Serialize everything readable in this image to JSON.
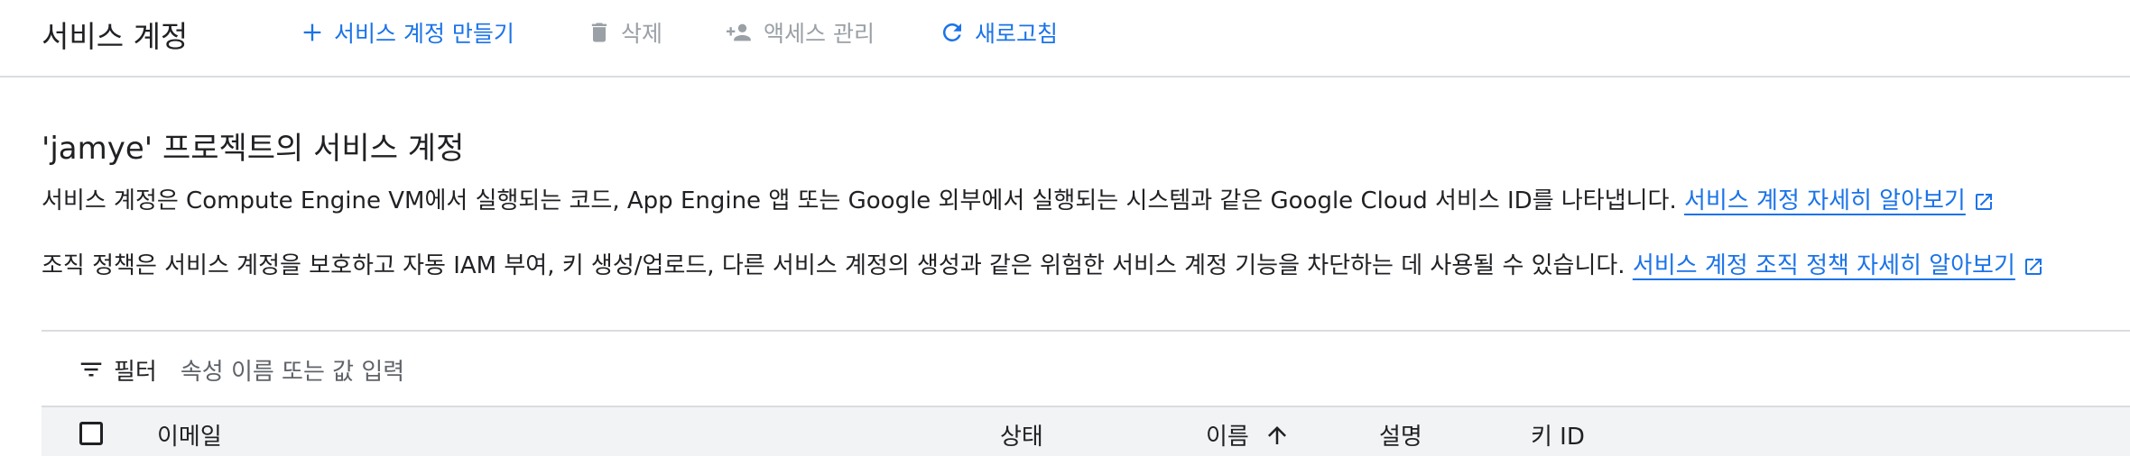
{
  "header": {
    "title": "서비스 계정",
    "actions": {
      "create": "서비스 계정 만들기",
      "delete": "삭제",
      "manage_access": "액세스 관리",
      "refresh": "새로고침"
    }
  },
  "main": {
    "section_title": "'jamye' 프로젝트의 서비스 계정",
    "description_1": "서비스 계정은 Compute Engine VM에서 실행되는 코드, App Engine 앱 또는 Google 외부에서 실행되는 시스템과 같은 Google Cloud 서비스 ID를 나타냅니다.",
    "link_1": "서비스 계정 자세히 알아보기",
    "description_2": "조직 정책은 서비스 계정을 보호하고 자동 IAM 부여, 키 생성/업로드, 다른 서비스 계정의 생성과 같은 위험한 서비스 계정 기능을 차단하는 데 사용될 수 있습니다.",
    "link_2": "서비스 계정 조직 정책 자세히 알아보기"
  },
  "filter": {
    "label": "필터",
    "placeholder": "속성 이름 또는 값 입력"
  },
  "table": {
    "columns": {
      "email": "이메일",
      "status": "상태",
      "name": "이름",
      "description": "설명",
      "key_id": "키 ID"
    }
  },
  "colors": {
    "accent": "#1a73e8",
    "disabled": "#9aa0a6",
    "header_bg": "#f1f3f4",
    "divider": "#dadce0"
  },
  "icons": [
    "plus-icon",
    "trash-icon",
    "person-add-icon",
    "refresh-icon",
    "external-link-icon",
    "filter-icon",
    "sort-arrow-up-icon"
  ]
}
